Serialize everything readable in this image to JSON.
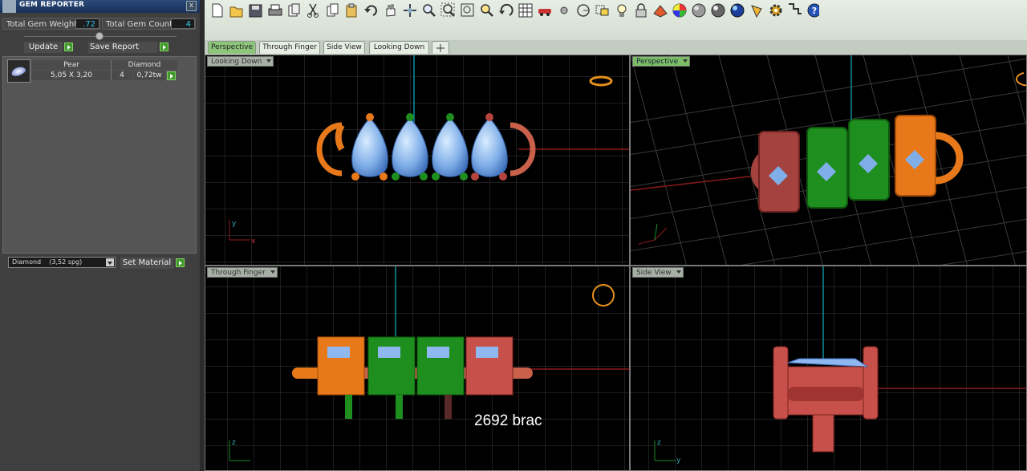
{
  "panel": {
    "title": "GEM REPORTER",
    "close_glyph": "x",
    "total_weight_label": "Total Gem Weight",
    "total_weight_value": ".72",
    "total_count_label": "Total Gem Count",
    "total_count_value": "4",
    "update_label": "Update",
    "save_report_label": "Save Report",
    "columns": [
      "Pear",
      "Diamond"
    ],
    "gem_row": {
      "size": "5,05 X 3,20",
      "count": "4",
      "weight": "0,72tw"
    },
    "material_value": "Diamond    (3,52 spg)",
    "set_material_label": "Set Material"
  },
  "toolbar": {
    "icons": [
      "new-file-icon",
      "open-folder-icon",
      "save-icon",
      "print-icon",
      "copy-doc-icon",
      "cut-icon",
      "copy-icon",
      "paste-icon",
      "undo-icon",
      "pan-hand-icon",
      "move-icon",
      "zoom-icon",
      "zoom-window-icon",
      "zoom-extents-icon",
      "zoom-selected-icon",
      "rotate-view-icon",
      "grid-icon",
      "car-icon",
      "point-icon",
      "circle-icon",
      "select-icon",
      "light-icon",
      "lock-icon",
      "material-icon",
      "color-wheel-icon",
      "sphere-icon",
      "render-sphere-icon",
      "blue-sphere-icon",
      "pin-icon",
      "gear-icon",
      "snap-icon",
      "help-icon"
    ]
  },
  "tabs": [
    "Perspective",
    "Through Finger",
    "Side View",
    "Looking Down"
  ],
  "viewports": {
    "top_left": "Looking Down",
    "top_right": "Perspective",
    "bottom_left": "Through Finger",
    "bottom_right": "Side View"
  },
  "overlay_caption": "2692 brac",
  "colors": {
    "orange": "#e8791a",
    "green": "#1f9a1f",
    "red": "#b5443e",
    "gem": "#8fb8f0",
    "grid": "#3a3a3a"
  }
}
